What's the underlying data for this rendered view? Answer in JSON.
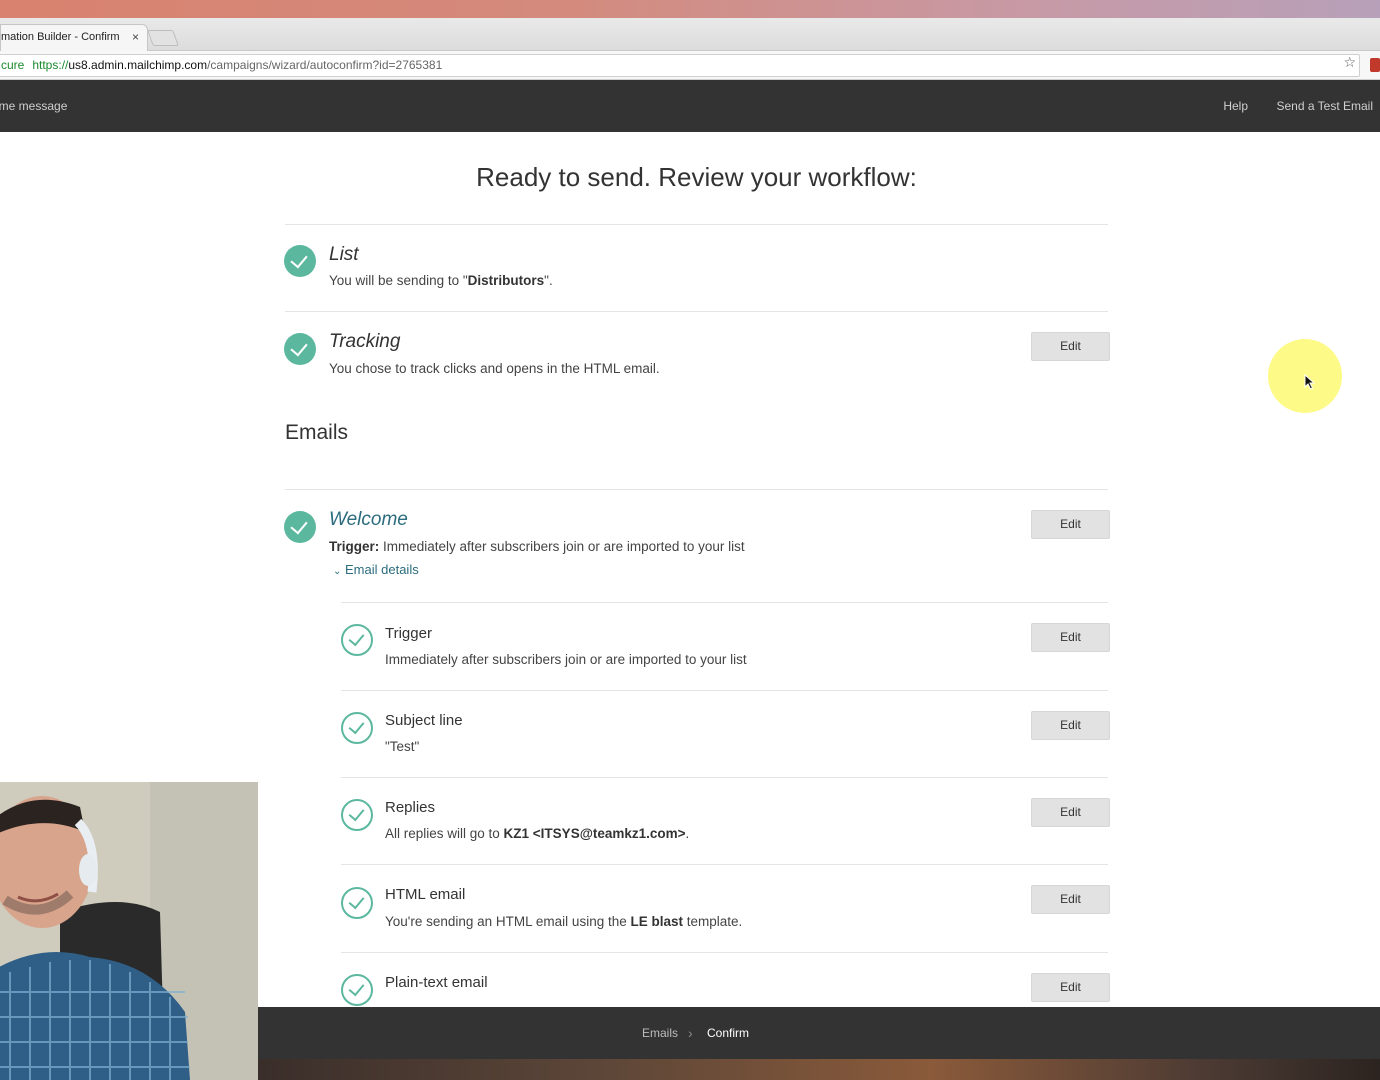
{
  "browser": {
    "tab_title": "mation Builder - Confirm |",
    "tab_close": "×",
    "url_prefix": "cure",
    "url_scheme": "https://",
    "url_host": "us8.admin.mailchimp.com",
    "url_path": "/campaigns/wizard/autoconfirm?id=2765381"
  },
  "appnav": {
    "left_label": "ome message",
    "help": "Help",
    "send_test": "Send a Test Email"
  },
  "page": {
    "title": "Ready to send. Review your workflow:",
    "list": {
      "title": "List",
      "desc_prefix": "You will be sending to \"",
      "desc_bold": "Distributors",
      "desc_suffix": "\"."
    },
    "tracking": {
      "title": "Tracking",
      "desc": "You chose to track clicks and opens in the HTML email.",
      "edit": "Edit"
    },
    "emails_heading": "Emails",
    "welcome": {
      "title": "Welcome",
      "trigger_label": "Trigger:",
      "trigger_text": " Immediately after subscribers join or are imported to your list",
      "details_link": "Email details",
      "edit": "Edit"
    },
    "details": [
      {
        "title": "Trigger",
        "desc": "Immediately after subscribers join or are imported to your list",
        "edit": "Edit"
      },
      {
        "title": "Subject line",
        "desc": "\"Test\"",
        "edit": "Edit"
      },
      {
        "title": "Replies",
        "desc_prefix": "All replies will go to ",
        "desc_bold": "KZ1 <ITSYS@teamkz1.com>",
        "desc_suffix": ".",
        "edit": "Edit"
      },
      {
        "title": "HTML email",
        "desc_prefix": "You're sending an HTML email using the ",
        "desc_bold": "LE blast",
        "desc_suffix": " template.",
        "edit": "Edit"
      },
      {
        "title": "Plain-text email",
        "edit": "Edit"
      }
    ]
  },
  "footer": {
    "crumb_emails": "Emails",
    "crumb_sep": "›",
    "crumb_confirm": "Confirm"
  },
  "colors": {
    "accent_green": "#5bb89f",
    "link_teal": "#2b6c7e",
    "nav_dark": "#333333",
    "cursor_highlight": "#fdf97a"
  }
}
